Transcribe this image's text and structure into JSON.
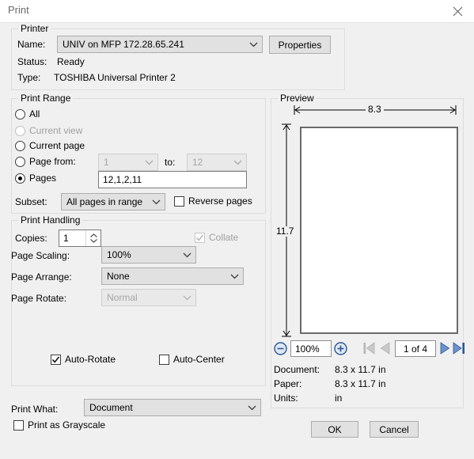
{
  "window": {
    "title": "Print",
    "close_icon": "close-icon"
  },
  "printer": {
    "legend": "Printer",
    "name_label": "Name:",
    "name_value": "UNIV on MFP 172.28.65.241",
    "properties_button": "Properties",
    "status_label": "Status:",
    "status_value": "Ready",
    "type_label": "Type:",
    "type_value": "TOSHIBA Universal Printer 2"
  },
  "print_range": {
    "legend": "Print Range",
    "options": [
      {
        "label": "All",
        "checked": false,
        "enabled": true
      },
      {
        "label": "Current view",
        "checked": false,
        "enabled": false
      },
      {
        "label": "Current page",
        "checked": false,
        "enabled": true
      },
      {
        "label": "Page from:",
        "checked": false,
        "enabled": true
      },
      {
        "label": "Pages",
        "checked": true,
        "enabled": true
      }
    ],
    "page_from_value": "1",
    "to_label": "to:",
    "page_to_value": "12",
    "pages_value": "12,1,2,11",
    "subset_label": "Subset:",
    "subset_value": "All pages in range",
    "reverse_pages_label": "Reverse pages",
    "reverse_pages_checked": false
  },
  "print_handling": {
    "legend": "Print Handling",
    "copies_label": "Copies:",
    "copies_value": "1",
    "collate_label": "Collate",
    "collate_checked": true,
    "collate_enabled": false,
    "page_scaling_label": "Page Scaling:",
    "page_scaling_value": "100%",
    "page_arrange_label": "Page Arrange:",
    "page_arrange_value": "None",
    "page_rotate_label": "Page Rotate:",
    "page_rotate_value": "Normal",
    "page_rotate_enabled": false,
    "auto_rotate_label": "Auto-Rotate",
    "auto_rotate_checked": true,
    "auto_center_label": "Auto-Center",
    "auto_center_checked": false
  },
  "print_what": {
    "label": "Print What:",
    "value": "Document",
    "grayscale_label": "Print as Grayscale",
    "grayscale_checked": false
  },
  "preview": {
    "legend": "Preview",
    "width_dim": "8.3",
    "height_dim": "11.7",
    "zoom_out_icon": "zoom-out-icon",
    "zoom_value": "100%",
    "zoom_in_icon": "zoom-in-icon",
    "first_page_icon": "first-page-icon",
    "prev_page_icon": "previous-page-icon",
    "page_indicator": "1 of 4",
    "next_page_icon": "next-page-icon",
    "last_page_icon": "last-page-icon",
    "document_label": "Document:",
    "document_value": "8.3 x 11.7 in",
    "paper_label": "Paper:",
    "paper_value": "8.3 x 11.7 in",
    "units_label": "Units:",
    "units_value": "in"
  },
  "footer": {
    "ok_button": "OK",
    "cancel_button": "Cancel"
  },
  "colors": {
    "accent_blue": "#2b5797",
    "disabled_gray": "#a0a0a0",
    "dialog_bg": "#f0f0f0"
  }
}
